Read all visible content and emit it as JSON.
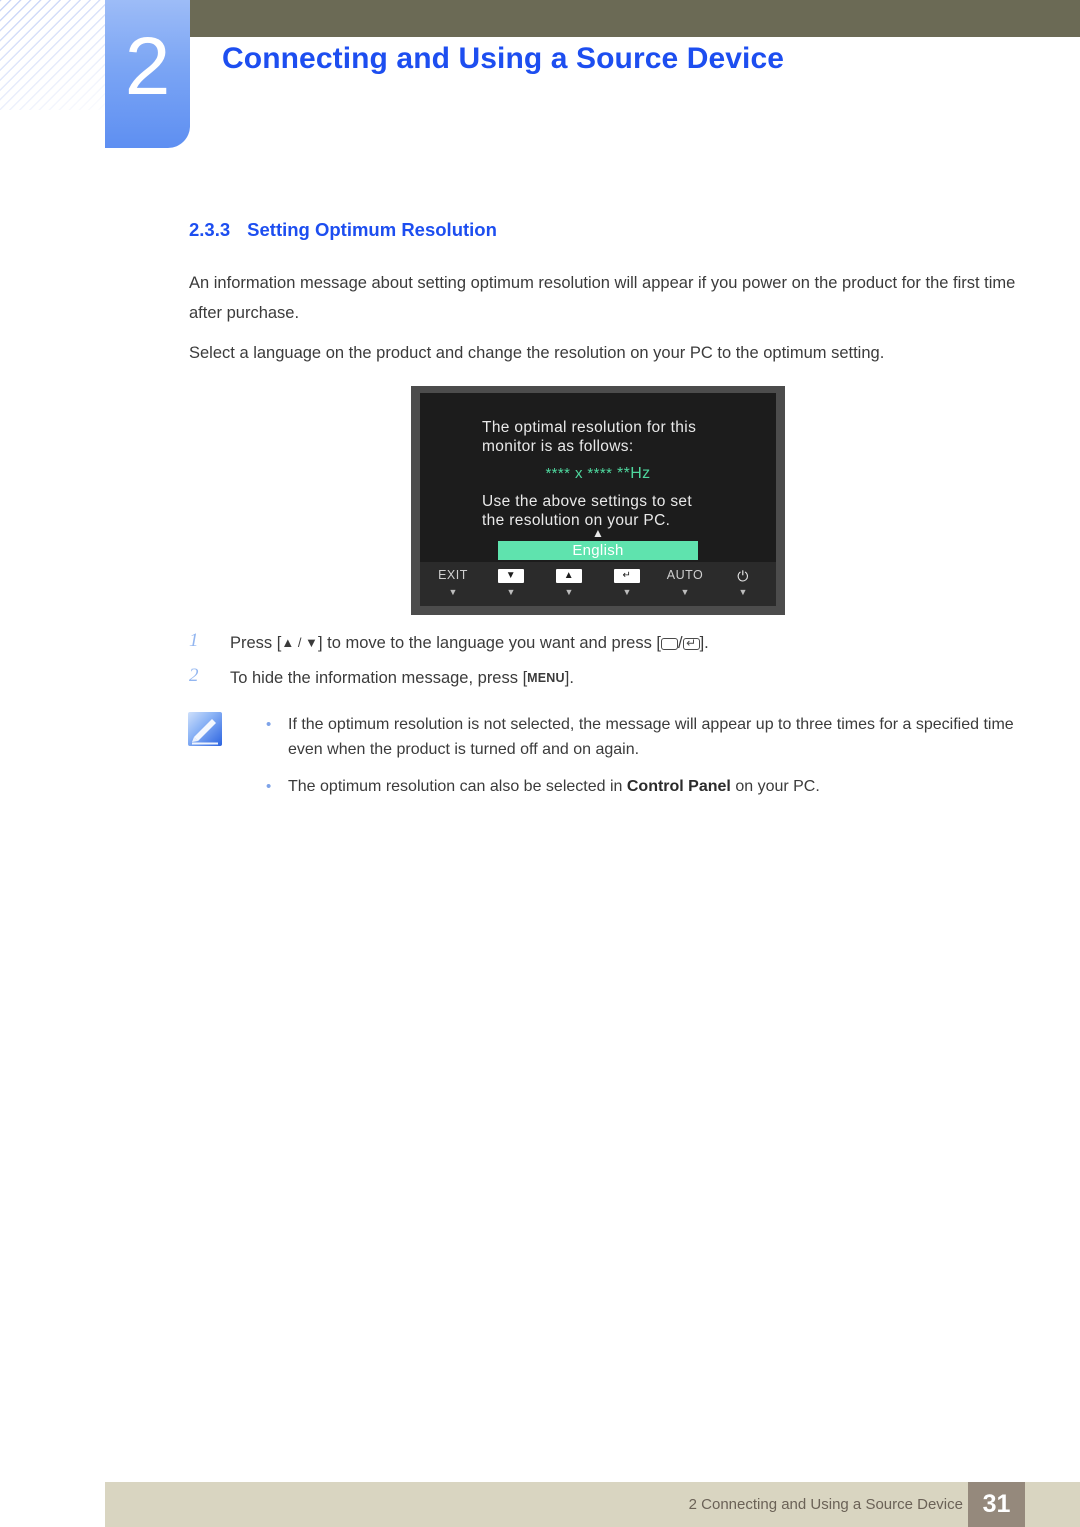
{
  "chapter": {
    "number": "2",
    "title": "Connecting and Using a Source Device"
  },
  "section": {
    "number": "2.3.3",
    "title": "Setting Optimum Resolution"
  },
  "paragraphs": {
    "p1": "An information message about setting optimum resolution will appear if you power on the product for the first time after purchase.",
    "p2": "Select a language on the product and change the resolution on your PC to the optimum setting."
  },
  "osd": {
    "message_line1": "The optimal resolution for this",
    "message_line2": "monitor is as follows:",
    "resolution": "**** x ****",
    "refresh": "**Hz",
    "instruction_line1": "Use the above settings to set",
    "instruction_line2": "the resolution on your PC.",
    "up_arrow": "▲",
    "down_arrow": "▼",
    "language_selected": "English",
    "highlight_color": "#5fe3ae",
    "accent_color": "#4fd79e",
    "buttons": [
      {
        "label": "EXIT",
        "type": "text",
        "tick": "▼"
      },
      {
        "label": "▼",
        "type": "key",
        "tick": "▼"
      },
      {
        "label": "▲",
        "type": "key",
        "tick": "▼"
      },
      {
        "label": "↵",
        "type": "key",
        "tick": "▼"
      },
      {
        "label": "AUTO",
        "type": "text",
        "tick": "▼"
      },
      {
        "label": "⏻",
        "type": "glyph",
        "tick": "▼"
      }
    ]
  },
  "steps": [
    {
      "number": "1",
      "before": "Press [",
      "keys": "▲ / ▼",
      "middle": "] to move to the language you want and press [",
      "after": "]."
    },
    {
      "number": "2",
      "before": "To hide the information message, press [",
      "key": "MENU",
      "after": "]."
    }
  ],
  "notes": {
    "icon_name": "note-pencil-icon",
    "items": [
      {
        "bullet": "•",
        "text": "If the optimum resolution is not selected, the message will appear up to three times for a specified time even when the product is turned off and on again.",
        "pre": "",
        "bold": "",
        "post": ""
      },
      {
        "bullet": "•",
        "pre": "The optimum resolution can also be selected in ",
        "bold": "Control Panel",
        "post": " on your PC."
      }
    ]
  },
  "footer": {
    "text": "2 Connecting and Using a Source Device",
    "page": "31",
    "bar_color": "#d9d5c1",
    "page_box_color": "#95897c"
  }
}
